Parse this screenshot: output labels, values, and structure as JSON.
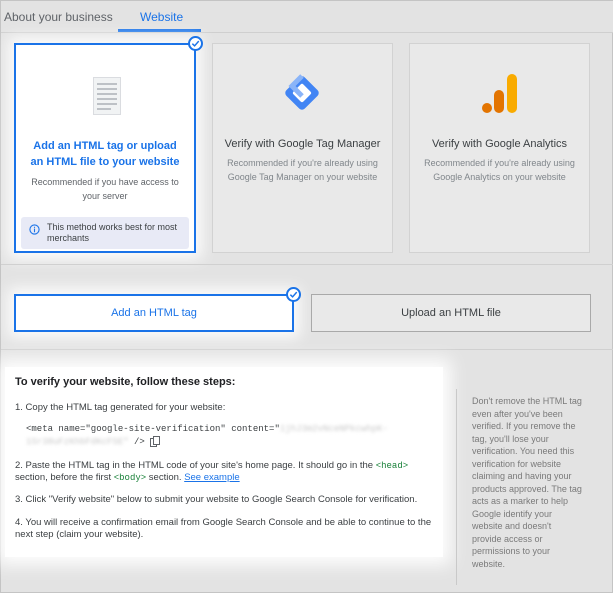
{
  "tabs": {
    "about": "About your business",
    "website": "Website"
  },
  "methods": {
    "html": {
      "title": "Add an HTML tag or upload an HTML file to your website",
      "description": "Recommended if you have access to your server",
      "tip": "This method works best for most merchants"
    },
    "gtm": {
      "title": "Verify with Google Tag Manager",
      "description": "Recommended if you're already using Google Tag Manager on your website"
    },
    "ga": {
      "title": "Verify with Google Analytics",
      "description": "Recommended if you're already using Google Analytics on your website"
    }
  },
  "options": {
    "tag": "Add an HTML tag",
    "file": "Upload an HTML file"
  },
  "steps": {
    "title": "To verify your website, follow these steps:",
    "step1": "1. Copy the HTML tag generated for your website:",
    "code_start": "<meta name=\"google-site-verification\" content=\"",
    "code_blurred1": "1jhJ3m2vNceNPkcwhpK-",
    "code_blurred2": "1Sr38uFzKhbFdKcFSE\"",
    "code_end": " />",
    "step2_a": "2. Paste the HTML tag in the HTML code of your site's home page. It should go in the ",
    "step2_head": "<head>",
    "step2_b": "section, before the first ",
    "step2_body": "<body>",
    "step2_c": " section. ",
    "step2_link": "See example",
    "step3": "3. Click \"Verify website\" below to submit your website to Google Search Console for verification.",
    "step4": "4. You will receive a confirmation email from Google Search Console and be able to continue to the next step (claim your website)."
  },
  "side_note": "Don't remove the HTML tag even after you've been verified. If you remove the tag, you'll lose your verification. You need this verification for website claiming and having your products approved. The tag acts as a marker to help Google identify your website and doesn't provide access or permissions to your website.",
  "colors": {
    "accent": "#1a73e8",
    "gtm_blue": "#4285f4",
    "ga_orange": "#f9ab00",
    "ga_dark": "#e37400"
  },
  "icons": [
    "check-icon",
    "document-icon",
    "tag-manager-icon",
    "analytics-icon",
    "info-icon",
    "copy-icon"
  ]
}
